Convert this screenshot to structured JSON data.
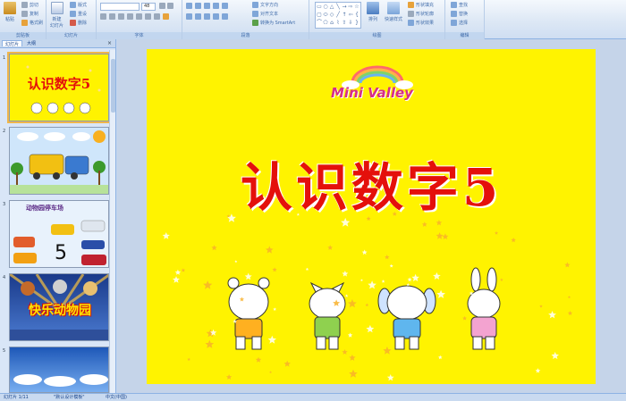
{
  "ribbon": {
    "clipboard": {
      "paste_label": "粘贴",
      "cut_label": "剪切",
      "copy_label": "复制",
      "format_painter_label": "格式刷",
      "group_label": "剪贴板"
    },
    "slides": {
      "new_slide_label": "新建\n幻灯片",
      "layout_label": "版式",
      "reset_label": "重设",
      "delete_label": "删除",
      "group_label": "幻灯片"
    },
    "font": {
      "size_value": "48",
      "group_label": "字体"
    },
    "paragraph": {
      "text_direction_label": "文字方向",
      "align_text_label": "对齐文本",
      "smartart_label": "转换为 SmartArt",
      "group_label": "段落"
    },
    "drawing": {
      "arrange_label": "排列",
      "quick_styles_label": "快速样式",
      "fill_label": "形状填充",
      "outline_label": "形状轮廓",
      "effects_label": "形状效果",
      "group_label": "绘图"
    },
    "editing": {
      "find_label": "查找",
      "replace_label": "替换",
      "select_label": "选择",
      "group_label": "编辑"
    }
  },
  "panel": {
    "tabs": [
      "幻灯片",
      "大纲"
    ],
    "close_glyph": "×",
    "thumbnails": [
      {
        "number": "1",
        "title": "认识数字5"
      },
      {
        "number": "2"
      },
      {
        "number": "3",
        "title": "动物园停车场",
        "digit": "5"
      },
      {
        "number": "4",
        "title": "快乐动物园"
      },
      {
        "number": "5"
      }
    ]
  },
  "slide": {
    "logo_text": "Mini Valley",
    "title": "认识数字5"
  },
  "status": {
    "slide_position": "幻灯片 1/11",
    "theme": "\"默认设计模板\"",
    "language": "中文(中国)"
  },
  "colors": {
    "slide_background": "#fff300",
    "title_color": "#e4100b",
    "ribbon_accent": "#15428b"
  }
}
